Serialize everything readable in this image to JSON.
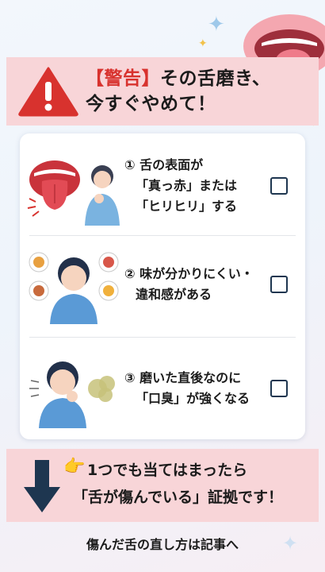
{
  "header": {
    "warning_word": "【警告】",
    "title_rest": "その舌磨き、",
    "title_line2": "今すぐやめて！"
  },
  "checklist": [
    {
      "number": "①",
      "lines": [
        "舌の表面が",
        "「真っ赤」または",
        "「ヒリヒリ」する"
      ]
    },
    {
      "number": "②",
      "lines": [
        "味が分かりにくい・",
        "違和感がある"
      ]
    },
    {
      "number": "③",
      "lines": [
        "磨いた直後なのに",
        "「口臭」が強くなる"
      ]
    }
  ],
  "footer": {
    "pointing_emoji": "👉",
    "line1": "1つでも当てはまったら",
    "line2": "「舌が傷んでいる」証拠です！"
  },
  "cta": {
    "label": "傷んだ舌の直し方は記事へ"
  },
  "colors": {
    "accent_red": "#d8322e",
    "band_pink": "#f8d5d8",
    "navy": "#1e3650"
  }
}
